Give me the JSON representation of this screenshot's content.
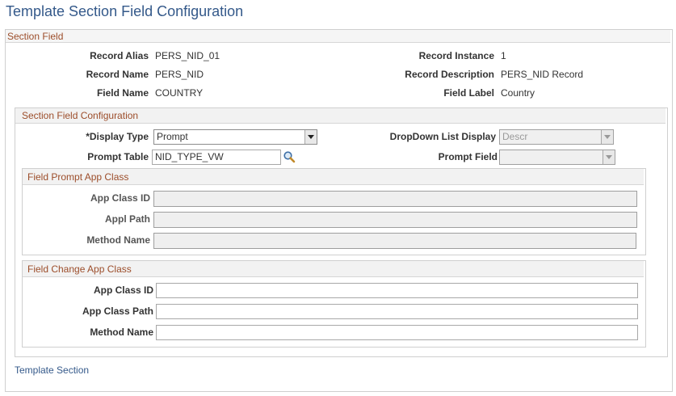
{
  "page_title": "Template Section Field Configuration",
  "section_field": {
    "header": "Section Field",
    "record_alias_label": "Record Alias",
    "record_alias": "PERS_NID_01",
    "record_instance_label": "Record Instance",
    "record_instance": "1",
    "record_name_label": "Record Name",
    "record_name": "PERS_NID",
    "record_description_label": "Record Description",
    "record_description": "PERS_NID Record",
    "field_name_label": "Field Name",
    "field_name": "COUNTRY",
    "field_label_label": "Field Label",
    "field_label": "Country"
  },
  "config": {
    "header": "Section Field Configuration",
    "display_type_label": "*Display Type",
    "display_type": "Prompt",
    "dropdown_display_label": "DropDown List Display",
    "dropdown_display": "Descr",
    "prompt_table_label": "Prompt Table",
    "prompt_table": "NID_TYPE_VW",
    "prompt_field_label": "Prompt Field",
    "prompt_field": ""
  },
  "prompt_app_class": {
    "header": "Field Prompt App Class",
    "app_class_id_label": "App Class ID",
    "app_class_id": "",
    "appl_path_label": "Appl Path",
    "appl_path": "",
    "method_name_label": "Method Name",
    "method_name": ""
  },
  "change_app_class": {
    "header": "Field Change App Class",
    "app_class_id_label": "App Class ID",
    "app_class_id": "",
    "app_class_path_label": "App Class Path",
    "app_class_path": "",
    "method_name_label": "Method Name",
    "method_name": ""
  },
  "template_section_link": "Template Section",
  "icons": {
    "prompt_lookup": "magnifier-icon",
    "dropdown": "chevron-down-icon"
  }
}
